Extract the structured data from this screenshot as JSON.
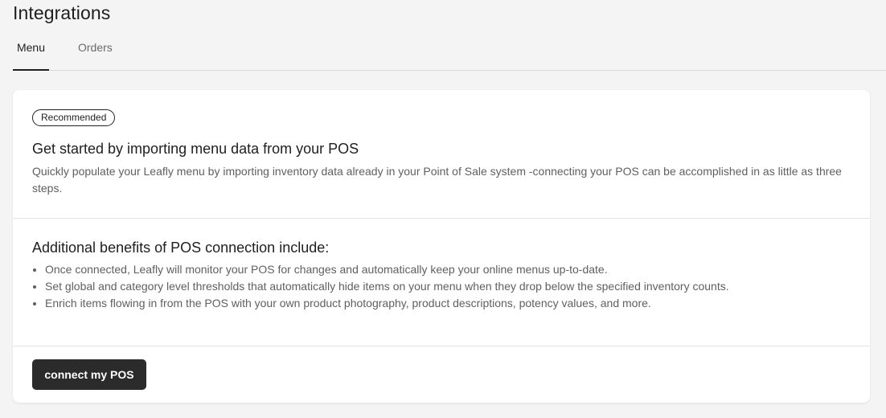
{
  "header": {
    "title": "Integrations"
  },
  "tabs": [
    {
      "label": "Menu",
      "active": true
    },
    {
      "label": "Orders",
      "active": false
    }
  ],
  "card": {
    "badge": "Recommended",
    "headline": "Get started by importing menu data from your POS",
    "description": "Quickly populate your Leafly menu by importing inventory data already in your Point of Sale system -connecting your POS can be accomplished in as little as three steps.",
    "benefits_title": "Additional benefits of POS connection include:",
    "benefits": [
      "Once connected, Leafly will monitor your POS for changes and automatically keep your online menus up-to-date.",
      "Set global and category level thresholds that automatically hide items on your menu when they drop below the specified inventory counts.",
      "Enrich items flowing in from the POS with your own product photography, product descriptions, potency values, and more."
    ],
    "button_label": "connect my POS"
  },
  "colors": {
    "background": "#f4f4f4",
    "card": "#ffffff",
    "primary_button": "#2b2b2b",
    "text_primary": "#1f1f1f",
    "text_secondary": "#5f5f5f",
    "divider": "#e3e3e3"
  }
}
